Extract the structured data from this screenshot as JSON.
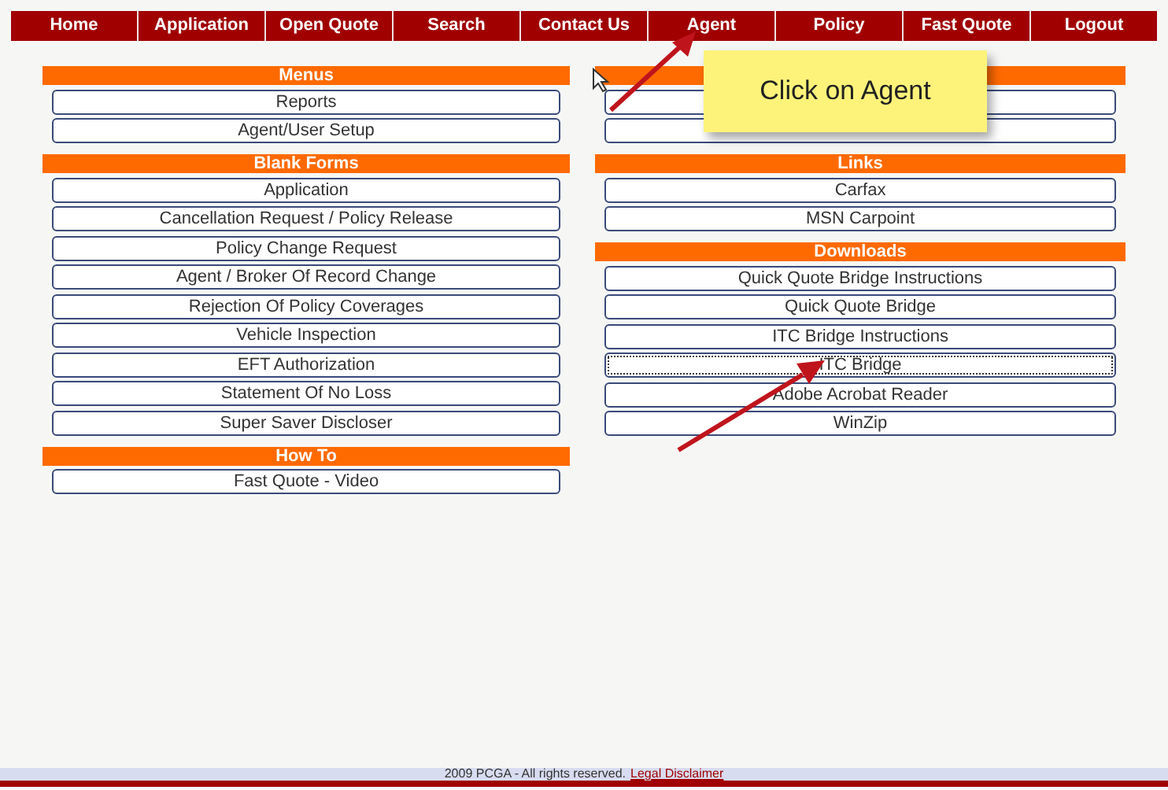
{
  "nav": [
    {
      "label": "Home"
    },
    {
      "label": "Application"
    },
    {
      "label": "Open Quote"
    },
    {
      "label": "Search"
    },
    {
      "label": "Contact Us"
    },
    {
      "label": "Agent"
    },
    {
      "label": "Policy"
    },
    {
      "label": "Fast Quote"
    },
    {
      "label": "Logout"
    }
  ],
  "left_sections": [
    {
      "title": "Menus",
      "items": [
        {
          "label": "Reports",
          "focused": false
        },
        {
          "label": "Agent/User Setup",
          "focused": false
        }
      ]
    },
    {
      "title": "Blank Forms",
      "items": [
        {
          "label": "Application",
          "focused": false
        },
        {
          "label": "Cancellation Request / Policy Release",
          "focused": false
        },
        {
          "label": "Policy Change Request",
          "focused": false
        },
        {
          "label": "Agent / Broker Of Record Change",
          "focused": false
        },
        {
          "label": "Rejection Of Policy Coverages",
          "focused": false
        },
        {
          "label": "Vehicle Inspection",
          "focused": false
        },
        {
          "label": "EFT Authorization",
          "focused": false
        },
        {
          "label": "Statement Of No Loss",
          "focused": false
        },
        {
          "label": "Super Saver Discloser",
          "focused": false
        }
      ]
    },
    {
      "title": "How To",
      "items": [
        {
          "label": "Fast Quote - Video",
          "focused": false
        }
      ]
    }
  ],
  "right_sections": [
    {
      "items": [
        {
          "focused": false
        },
        {
          "focused": false
        }
      ]
    },
    {
      "title": "Links",
      "items": [
        {
          "label": "Carfax",
          "focused": false
        },
        {
          "label": "MSN Carpoint",
          "focused": false
        }
      ]
    },
    {
      "title": "Downloads",
      "items": [
        {
          "label": "Quick Quote Bridge Instructions",
          "focused": false
        },
        {
          "label": "Quick Quote Bridge",
          "focused": false
        },
        {
          "label": "ITC Bridge Instructions",
          "focused": false
        },
        {
          "label": "ITC Bridge",
          "focused": true
        },
        {
          "label": "Adobe Acrobat Reader",
          "focused": false
        },
        {
          "label": "WinZip",
          "focused": false
        }
      ]
    }
  ],
  "callout": {
    "text": "Click on Agent"
  },
  "footer": {
    "text": "2009 PCGA - All rights reserved.",
    "link": "Legal Disclaimer"
  }
}
